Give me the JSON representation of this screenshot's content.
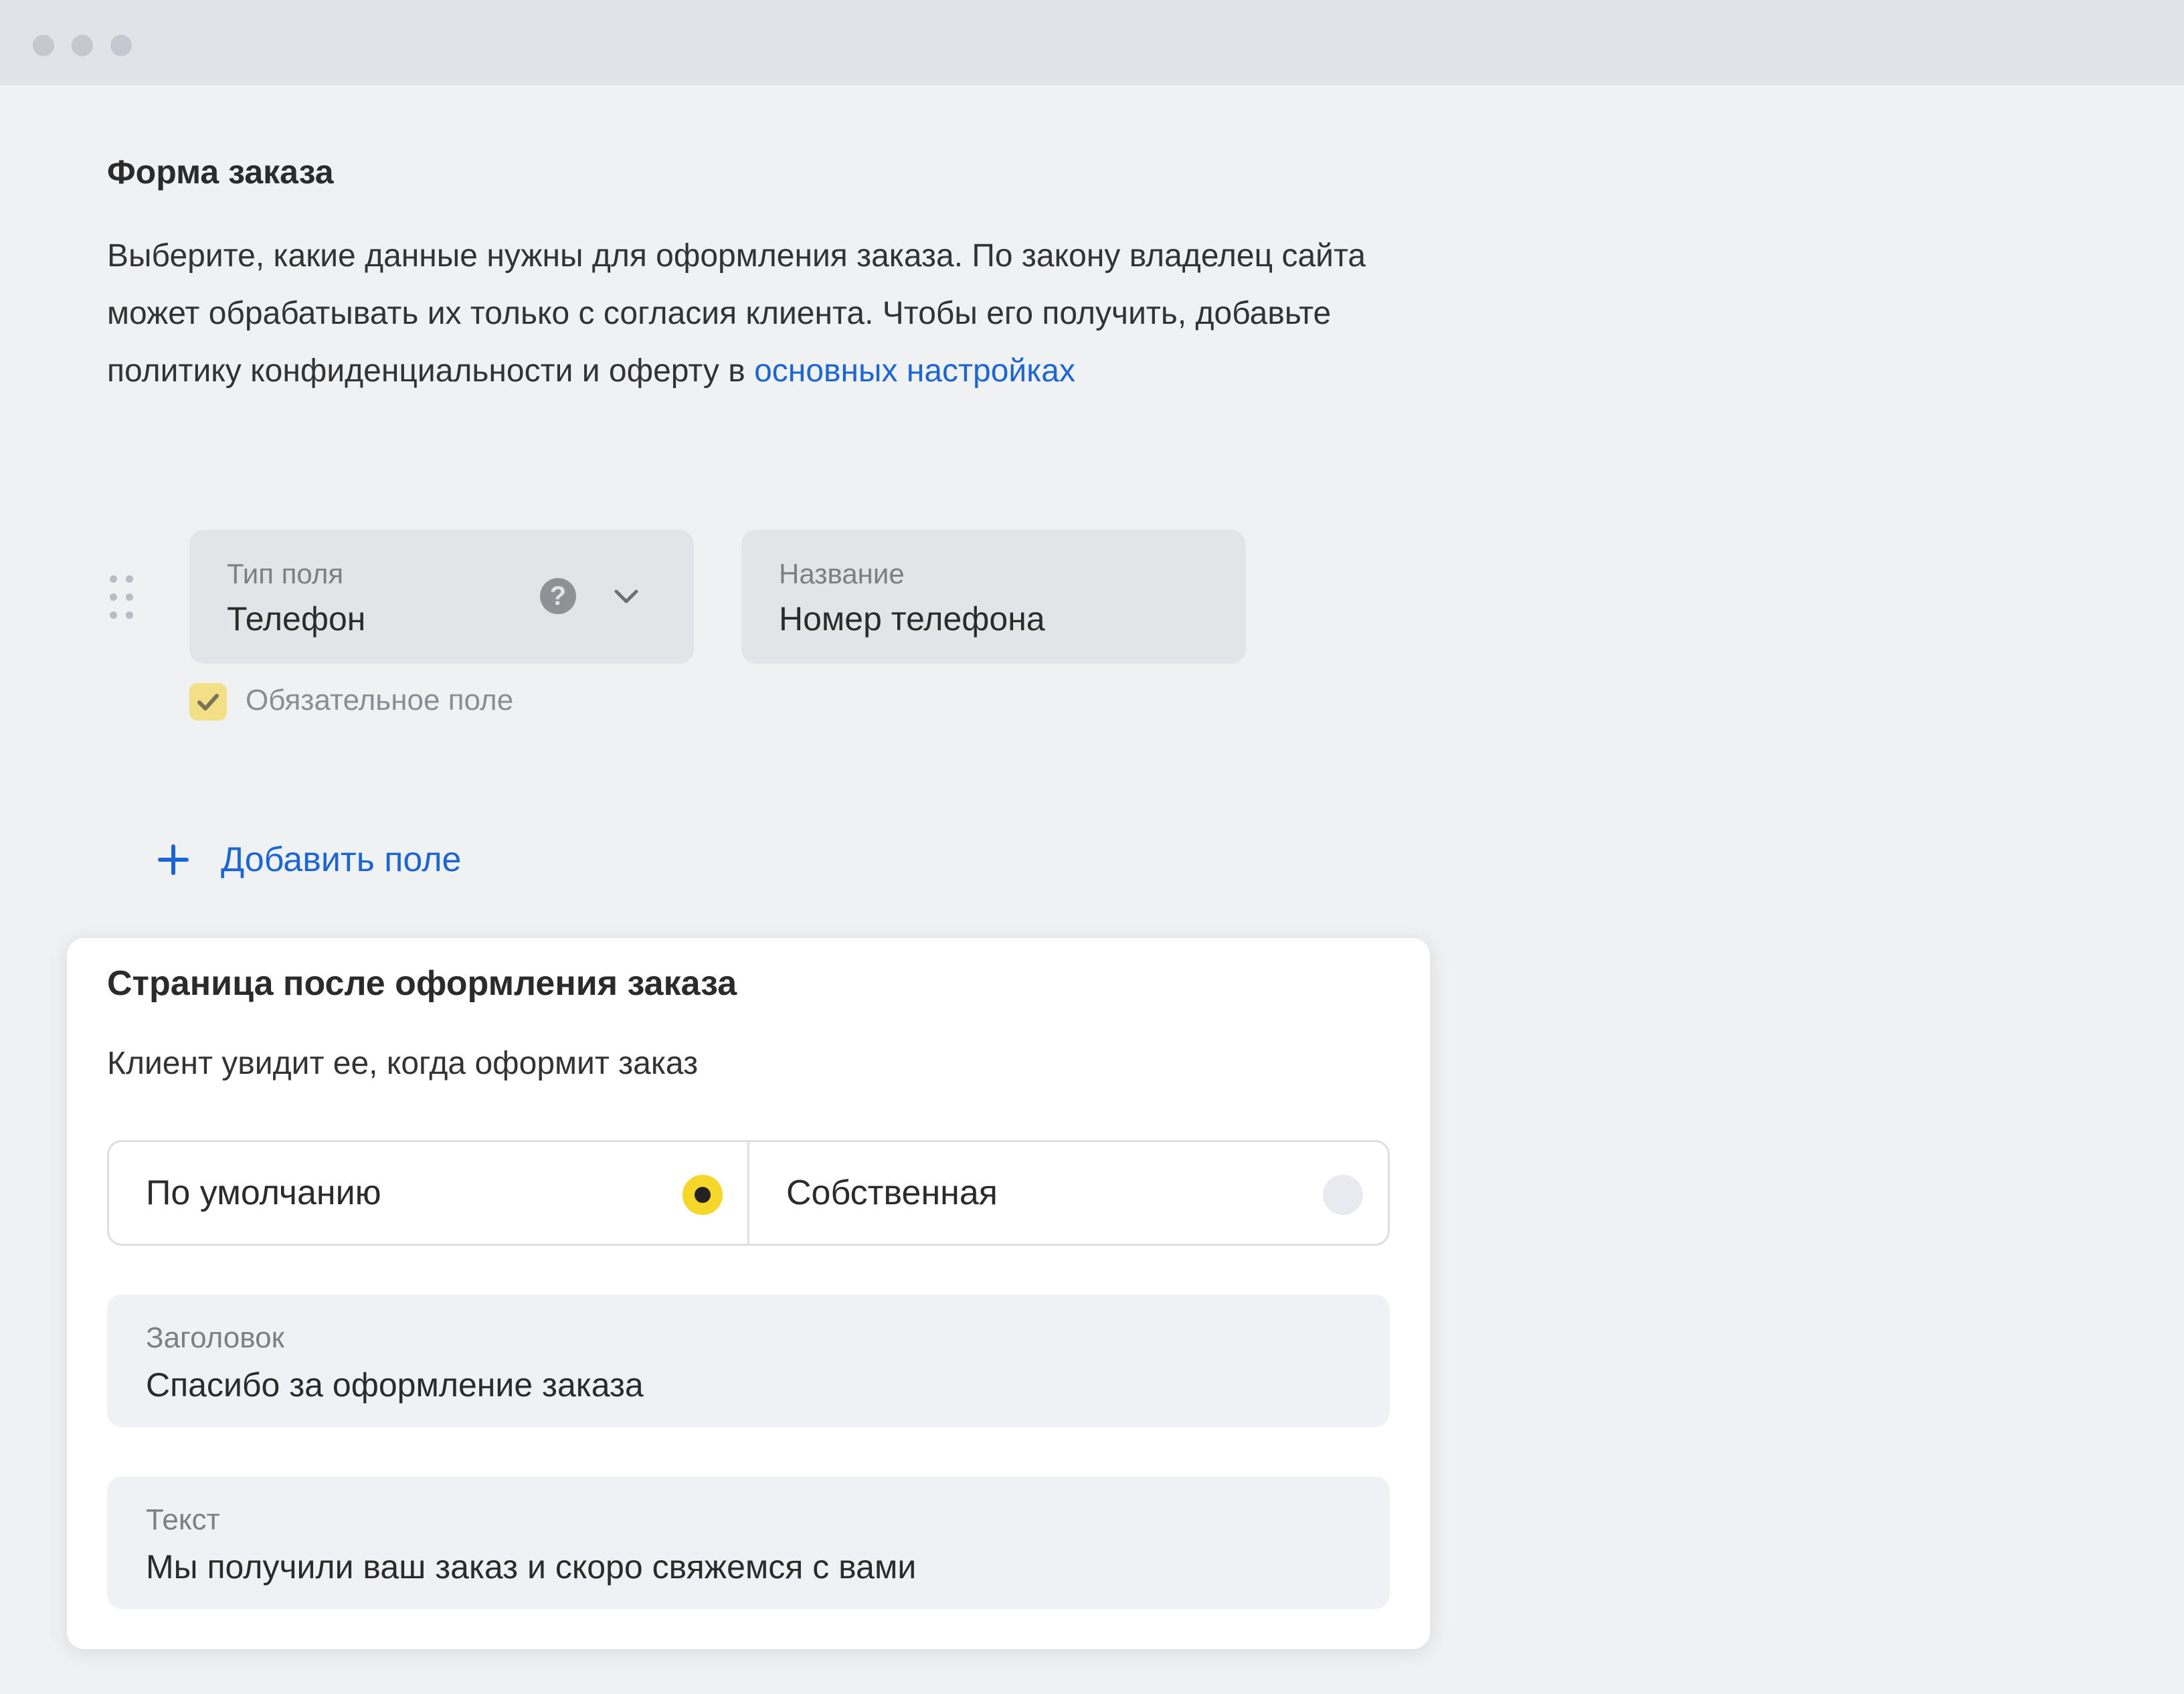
{
  "window": {
    "controls": [
      "dot",
      "dot",
      "dot"
    ]
  },
  "order_form": {
    "title": "Форма заказа",
    "description_before_link": "Выберите, какие данные нужны для оформления заказа. По закону владелец сайта может обрабатывать их только с согласия клиента. Чтобы его получить, добавьте политику конфиденциальности и оферту в ",
    "description_link": "основных настройках",
    "field": {
      "type_label": "Тип поля",
      "type_value": "Телефон",
      "name_label": "Название",
      "name_value": "Номер телефона",
      "required_label": "Обязательное поле",
      "required_checked": true
    },
    "add_field_label": "Добавить поле"
  },
  "after_order_page": {
    "title": "Страница после оформления заказа",
    "subtitle": "Клиент увидит ее, когда оформит заказ",
    "options": [
      {
        "label": "По умолчанию",
        "selected": true
      },
      {
        "label": "Собственная",
        "selected": false
      }
    ],
    "heading_field": {
      "label": "Заголовок",
      "value": "Спасибо за оформление заказа"
    },
    "text_field": {
      "label": "Текст",
      "value": "Мы получили ваш заказ и скоро свяжемся с вами"
    }
  },
  "colors": {
    "accent_link": "#1a66d9",
    "radio_selected": "#f7d62a",
    "checkbox": "#f3df86"
  },
  "icons": {
    "help": "question-circle-icon",
    "dropdown": "chevron-down-icon",
    "drag": "drag-handle-icon",
    "check": "check-icon",
    "add": "plus-icon"
  }
}
